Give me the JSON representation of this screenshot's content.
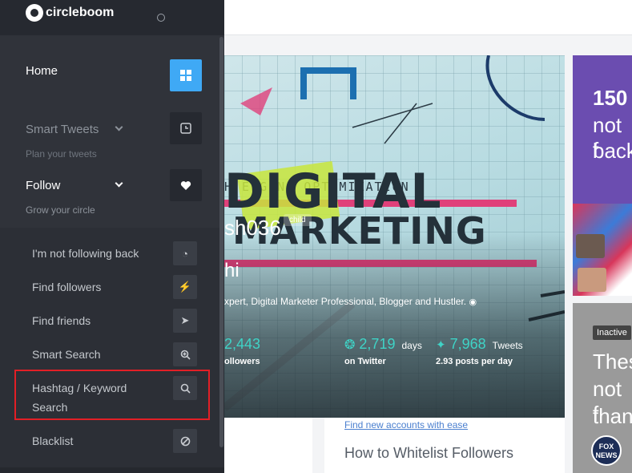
{
  "brand": {
    "name": "circleboom"
  },
  "sidebar": {
    "home": {
      "label": "Home"
    },
    "smart_tweets": {
      "label": "Smart Tweets",
      "sub": "Plan your tweets"
    },
    "follow": {
      "label": "Follow",
      "sub": "Grow your circle"
    },
    "follow_items": [
      {
        "label": "I'm not following back",
        "icon": "compass-icon"
      },
      {
        "label": "Find followers",
        "icon": "bolt-icon"
      },
      {
        "label": "Find friends",
        "icon": "rocket-icon"
      },
      {
        "label": "Smart Search",
        "icon": "zoom-icon"
      },
      {
        "label": "Hashtag / Keyword",
        "label2": "Search",
        "icon": "search-icon"
      },
      {
        "label": "Blacklist",
        "icon": "ban-icon"
      }
    ]
  },
  "hero": {
    "seo_text": "H ENGINE OPTIMIZATION",
    "word1": "DIGITAL",
    "word2": "MARKETING",
    "username": "sh036",
    "badge": "child",
    "short_name": "hi",
    "bio": "xpert, Digital Marketer Professional, Blogger and Hustler.",
    "stats": [
      {
        "value": "2,443",
        "unit": "",
        "sub": "ollowers"
      },
      {
        "value": "2,719",
        "unit": "days",
        "sub": "on Twitter"
      },
      {
        "value": "7,968",
        "unit": "Tweets",
        "sub": "2.93 posts per day"
      }
    ]
  },
  "card_bottom": {
    "link": "Find new accounts with ease",
    "title": "How to Whitelist Followers"
  },
  "right_cards": {
    "card1": {
      "line1": "150",
      "line2": "not f",
      "line3": "back"
    },
    "card2": {
      "badge": "Inactive",
      "line1": "Thes",
      "line2": "not f",
      "line3": "than",
      "logo": "FOX NEWS"
    }
  },
  "colors": {
    "accent": "#3fa9f5",
    "highlight": "#e21f26",
    "stat": "#3fd3c6"
  }
}
